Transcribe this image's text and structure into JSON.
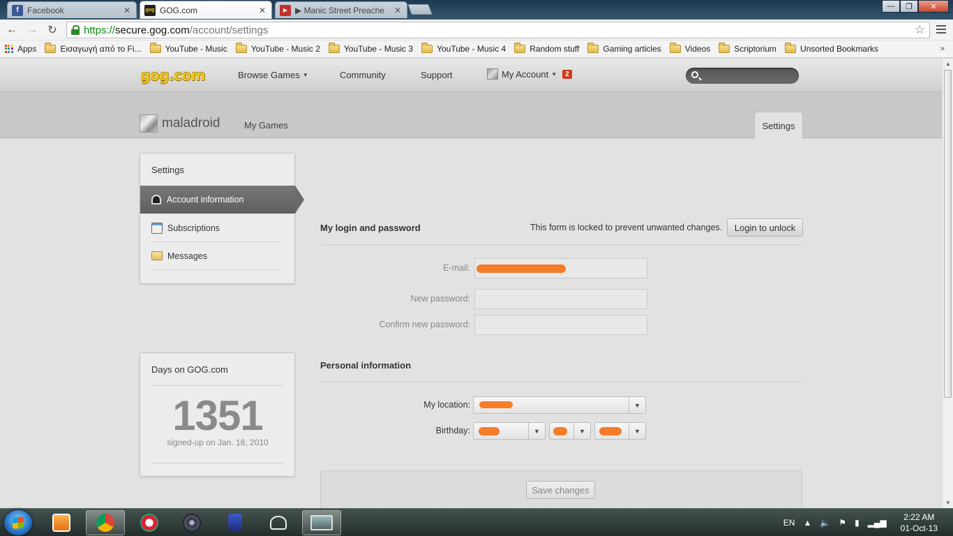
{
  "browser": {
    "tabs": [
      {
        "title": "Facebook",
        "favicon": "facebook-icon"
      },
      {
        "title": "GOG.com",
        "favicon": "gog-icon"
      },
      {
        "title": "▶ Manic Street Preache",
        "favicon": "youtube-icon"
      }
    ],
    "url": {
      "scheme": "https://",
      "host": "secure.gog.com",
      "path": "/account/settings"
    },
    "bookmarks": [
      "Apps",
      "Εισαγωγή από το Fi...",
      "YouTube - Music",
      "YouTube - Music 2",
      "YouTube - Music 3",
      "YouTube - Music 4",
      "Random stuff",
      "Gaming articles",
      "Videos",
      "Scriptorium",
      "Unsorted Bookmarks"
    ],
    "bookmarks_more": "»"
  },
  "site": {
    "logo": {
      "left": "gog",
      "dot": ".",
      "right": "com"
    },
    "nav": {
      "browse": "Browse Games",
      "community": "Community",
      "support": "Support",
      "account": "My Account",
      "account_badge": "2"
    }
  },
  "profile": {
    "username": "maladroid",
    "my_games": "My Games",
    "settings_tab": "Settings"
  },
  "sidebar": {
    "title": "Settings",
    "items": [
      {
        "label": "Account information",
        "icon": "user-icon"
      },
      {
        "label": "Subscriptions",
        "icon": "newsletter-icon"
      },
      {
        "label": "Messages",
        "icon": "messages-icon"
      }
    ]
  },
  "days": {
    "title": "Days on GOG.com",
    "count": "1351",
    "signed_up": "signed-up on Jan. 18, 2010"
  },
  "login_form": {
    "title": "My login and password",
    "locked_message": "This form is locked to prevent unwanted changes.",
    "unlock_button": "Login to unlock",
    "email_label": "E-mail:",
    "new_password_label": "New password:",
    "confirm_password_label": "Confirm new password:"
  },
  "personal": {
    "title": "Personal information",
    "location_label": "My location:",
    "birthday_label": "Birthday:"
  },
  "save_button": "Save changes",
  "taskbar": {
    "language": "EN",
    "time": "2:22 AM",
    "date": "01-Oct-13"
  },
  "colors": {
    "redaction": "#f57c29",
    "gog_yellow": "#f6c61a",
    "badge_red": "#d13a1e",
    "secure_green": "#0b8a0b"
  }
}
